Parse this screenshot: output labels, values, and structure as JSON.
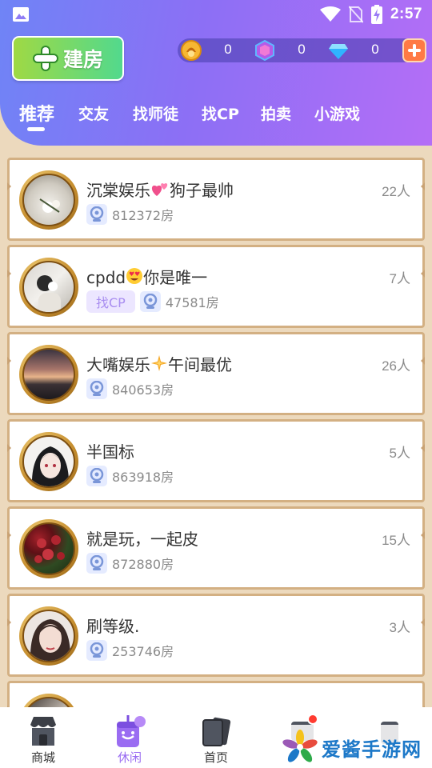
{
  "status_bar": {
    "time": "2:57"
  },
  "header": {
    "build_button_label": "建房",
    "currencies": [
      {
        "icon": "gold-coin-icon",
        "value": "0"
      },
      {
        "icon": "gem-icon",
        "value": "0"
      },
      {
        "icon": "diamond-icon",
        "value": "0"
      }
    ],
    "tabs": [
      {
        "label": "推荐",
        "active": true
      },
      {
        "label": "交友",
        "active": false
      },
      {
        "label": "找师徒",
        "active": false
      },
      {
        "label": "找CP",
        "active": false
      },
      {
        "label": "拍卖",
        "active": false
      },
      {
        "label": "小游戏",
        "active": false
      }
    ]
  },
  "rooms": [
    {
      "name_a": "沉棠娱乐",
      "emoji": "two-hearts-icon",
      "name_b": "狗子最帅",
      "count": "22人",
      "tag": "",
      "room_id": "812372房"
    },
    {
      "name_a": "cpdd",
      "emoji": "heart-eyes-icon",
      "name_b": "你是唯一",
      "count": "7人",
      "tag": "找CP",
      "room_id": "47581房"
    },
    {
      "name_a": "大嘴娱乐",
      "emoji": "sparkle-icon",
      "name_b": "午间最优",
      "count": "26人",
      "tag": "",
      "room_id": "840653房"
    },
    {
      "name_a": "半国标",
      "emoji": "",
      "name_b": "",
      "count": "5人",
      "tag": "",
      "room_id": "863918房"
    },
    {
      "name_a": "就是玩，一起皮",
      "emoji": "",
      "name_b": "",
      "count": "15人",
      "tag": "",
      "room_id": "872880房"
    },
    {
      "name_a": "刷等级.",
      "emoji": "",
      "name_b": "",
      "count": "3人",
      "tag": "",
      "room_id": "253746房"
    }
  ],
  "bottom_nav": [
    {
      "label": "商城",
      "icon": "shop-icon",
      "active": false
    },
    {
      "label": "休闲",
      "icon": "leisure-drink-icon",
      "active": true
    },
    {
      "label": "首页",
      "icon": "home-cards-icon",
      "active": false
    },
    {
      "label": "",
      "icon": "message-icon",
      "active": false
    },
    {
      "label": "",
      "icon": "profile-icon",
      "active": false
    }
  ],
  "watermark": "爱酱手游网",
  "colors": {
    "accent": "#9a6cf2",
    "header_start": "#6f84f6",
    "header_end": "#b46ef6",
    "list_bg": "#ecd9bd",
    "card_border": "#d3b083"
  }
}
